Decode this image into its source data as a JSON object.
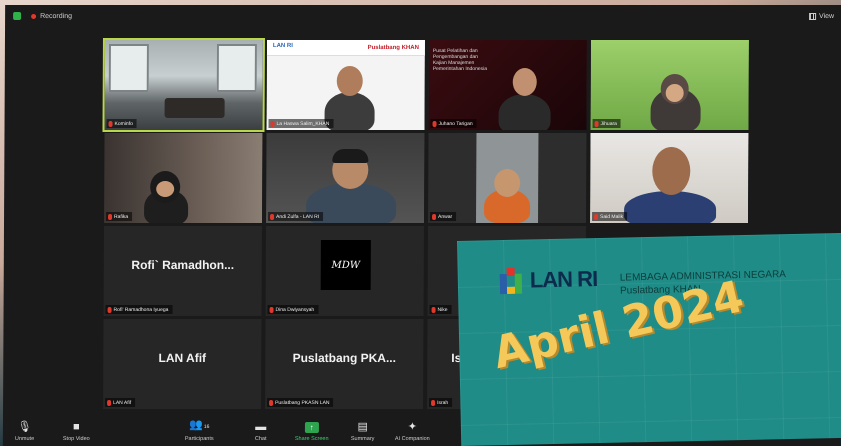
{
  "topbar": {
    "recording": "Recording",
    "view": "View"
  },
  "tiles": [
    {
      "name": "Kominfo",
      "muted": true
    },
    {
      "name": "La Haswa Salim_KHAN",
      "muted": true,
      "slide_brand": "LAN RI",
      "slide_title": "Puslatbang KHAN"
    },
    {
      "name": "Juhano Tarigan",
      "muted": true,
      "slide_title": "Pusat Pelatihan dan Pengembangan dan Kajian Manajemen Pemerintahan Indonesia"
    },
    {
      "name": "Jihuara",
      "muted": true
    },
    {
      "name": "Rafika",
      "muted": true
    },
    {
      "name": "Andi Zulfa - LAN RI",
      "muted": true
    },
    {
      "name": "Anwar",
      "muted": true
    },
    {
      "name": "Said Malik",
      "muted": true
    },
    {
      "name": "Rofi' Ramadhona Iyuega",
      "muted": true,
      "display": "Rofi` Ramadhon..."
    },
    {
      "name": "Dina Dwiyansyah",
      "muted": true,
      "logo": "MDW"
    },
    {
      "name": "Nike",
      "muted": true
    },
    {
      "name": "LAN Afif",
      "muted": true,
      "display": "LAN Afif"
    },
    {
      "name": "Puslatbang PKASN LAN",
      "muted": true,
      "display": "Puslatbang  PKA..."
    },
    {
      "name": "Israh",
      "muted": true,
      "display": "Is"
    }
  ],
  "overlay": {
    "brand": "LAN RI",
    "org_line1": "LEMBAGA ADMINISTRASI NEGARA",
    "org_line2": "Puslatbang KHAN",
    "date": "April 2024"
  },
  "toolbar": {
    "unmute": "Unmute",
    "stop_video": "Stop Video",
    "participants": "Participants",
    "participants_count": "16",
    "chat": "Chat",
    "share_screen": "Share Screen",
    "summary": "Summary",
    "ai_companion": "AI Companion"
  },
  "colors": {
    "active_speaker": "#b8d84a",
    "mute_red": "#e0392b",
    "share_green": "#2ea44f",
    "overlay_teal": "#1f8c87",
    "date_gold": "#f4c95a"
  }
}
